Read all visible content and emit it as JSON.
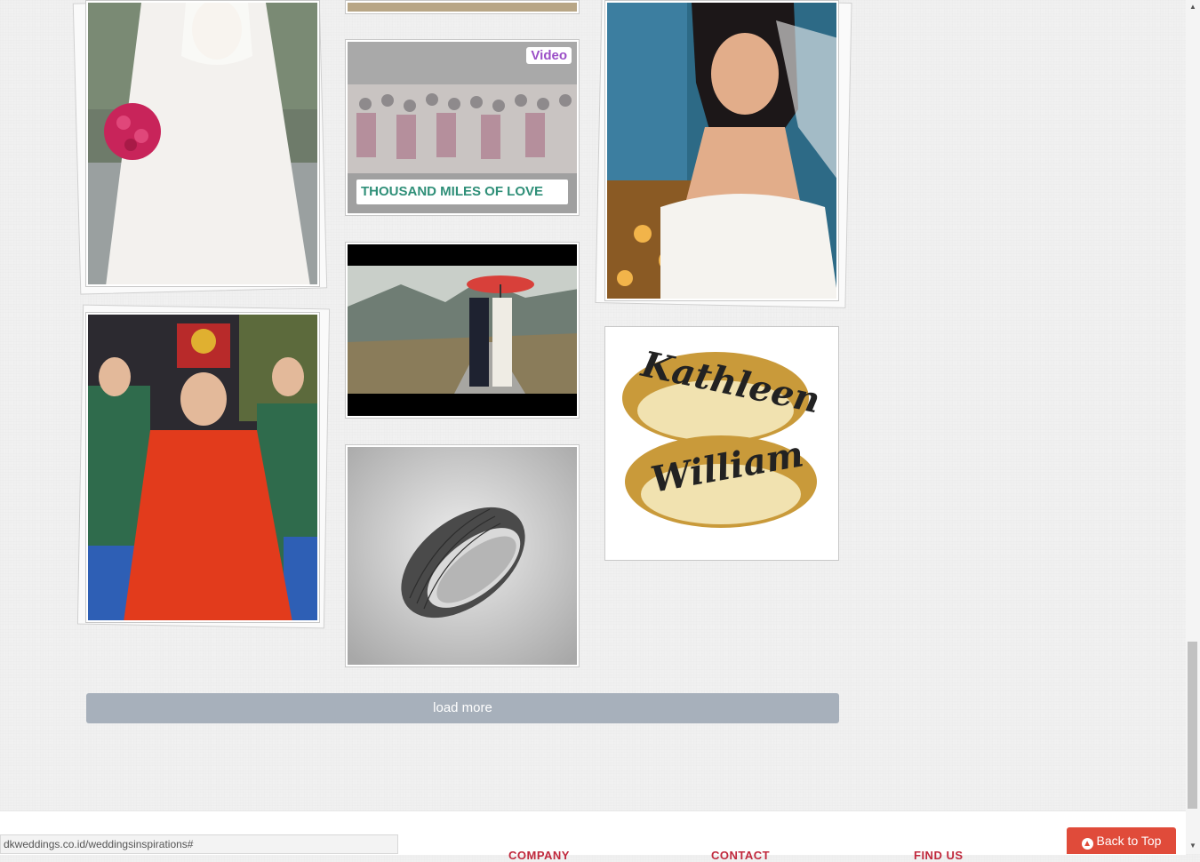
{
  "gallery": {
    "video_badge": "Video",
    "video_title": "THOUSAND MILES OF LOVE",
    "ring_left_name": "Kathleen",
    "ring_right_name": "William"
  },
  "load_more": {
    "label": "load more"
  },
  "footer": {
    "col1": "COMPANY",
    "col2": "CONTACT",
    "col3": "FIND US"
  },
  "status_bar": {
    "url": "dkweddings.co.id/weddingsinspirations#"
  },
  "back_to_top": {
    "label": "Back to Top",
    "icon": "arrow-up-circle-icon"
  },
  "colors": {
    "accent": "#c0283c",
    "button": "#a7b0bb",
    "back_top": "#e04b3a",
    "video_badge": "#9b4fc7",
    "video_title": "#2f8f78"
  }
}
